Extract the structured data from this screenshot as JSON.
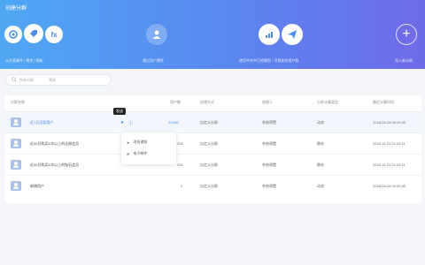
{
  "header": {
    "title": "创建分群"
  },
  "actions": [
    {
      "icon": "gear-icon",
      "label": ""
    },
    {
      "icon": "tag-icon",
      "label": ""
    },
    {
      "icon": "fx-icon",
      "label": "fx"
    },
    {
      "icon": "user-group-icon",
      "label": ""
    },
    {
      "icon": "chart-icon",
      "label": ""
    },
    {
      "icon": "send-icon",
      "label": ""
    }
  ],
  "captions": [
    "从任意事件 / 属性 / 指标",
    "通过用户属性",
    "使用平台中已经模型 / 可视化的用户群",
    "导入新分群"
  ],
  "add_button": "+",
  "search": {
    "placeholder": "所有分群",
    "filter": "筛选"
  },
  "table": {
    "headers": [
      "分群名称",
      "用户数",
      "创建方式",
      "创建人",
      "分群计算类型",
      "最近计算时间"
    ],
    "rows": [
      {
        "name": "近7日活跃用户",
        "count": "23,692",
        "method": "自定义分群",
        "creator": "系统预置",
        "type": "动态",
        "time": "2018-04-28 00:30:45"
      },
      {
        "name": "近30日购买E次以上的注册会员",
        "count": "201",
        "method": "自定义分群",
        "creator": "系统预置",
        "type": "静态",
        "time": "2018-11-21 21:02:11"
      },
      {
        "name": "近30日购买E次以上的钻石会员",
        "count": "201",
        "method": "自定义分群",
        "creator": "系统预置",
        "type": "静态",
        "time": "2018-11-21 21:02:11"
      },
      {
        "name": "新增用户",
        "count": "0",
        "method": "自定义分群",
        "creator": "系统预置",
        "type": "动态",
        "time": "2018-04-28 00:30:45"
      }
    ]
  },
  "tooltip": "发送",
  "menu": [
    {
      "icon": "send-icon",
      "label": "消息通知"
    },
    {
      "icon": "mail-icon",
      "label": "电子邮件"
    }
  ]
}
